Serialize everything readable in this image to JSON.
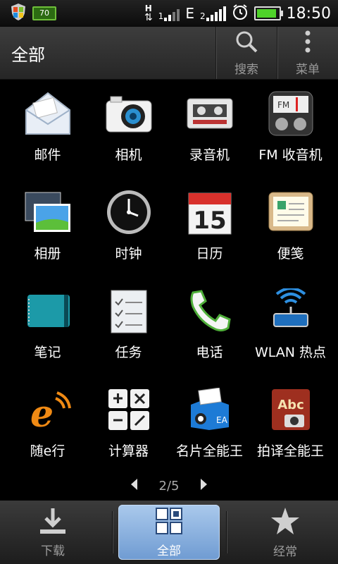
{
  "status": {
    "battery_percent_small": "70",
    "network_h": "H",
    "network_e": "E",
    "sim2_label": "2",
    "sim1_label": "1",
    "time": "18:50"
  },
  "actionbar": {
    "title": "全部",
    "search_label": "搜索",
    "menu_label": "菜单"
  },
  "apps": [
    {
      "label": "邮件",
      "icon": "mail-icon"
    },
    {
      "label": "相机",
      "icon": "camera-icon"
    },
    {
      "label": "录音机",
      "icon": "tape-recorder-icon"
    },
    {
      "label": "FM 收音机",
      "icon": "radio-icon"
    },
    {
      "label": "相册",
      "icon": "gallery-icon"
    },
    {
      "label": "时钟",
      "icon": "clock-icon"
    },
    {
      "label": "日历",
      "icon": "calendar-icon"
    },
    {
      "label": "便笺",
      "icon": "notes-icon"
    },
    {
      "label": "笔记",
      "icon": "notebook-icon"
    },
    {
      "label": "任务",
      "icon": "tasks-icon"
    },
    {
      "label": "电话",
      "icon": "phone-icon"
    },
    {
      "label": "WLAN 热点",
      "icon": "wifi-hotspot-icon"
    },
    {
      "label": "随e行",
      "icon": "e-app-icon"
    },
    {
      "label": "计算器",
      "icon": "calculator-icon"
    },
    {
      "label": "名片全能王",
      "icon": "business-card-icon"
    },
    {
      "label": "拍译全能王",
      "icon": "photo-translate-icon"
    }
  ],
  "calendar_day": "15",
  "pager": {
    "text": "2/5"
  },
  "tabs": {
    "download": "下载",
    "all": "全部",
    "frequent": "经常"
  },
  "colors": {
    "tab_active": "#8fb3e2",
    "battery_green": "#4fd22a"
  }
}
